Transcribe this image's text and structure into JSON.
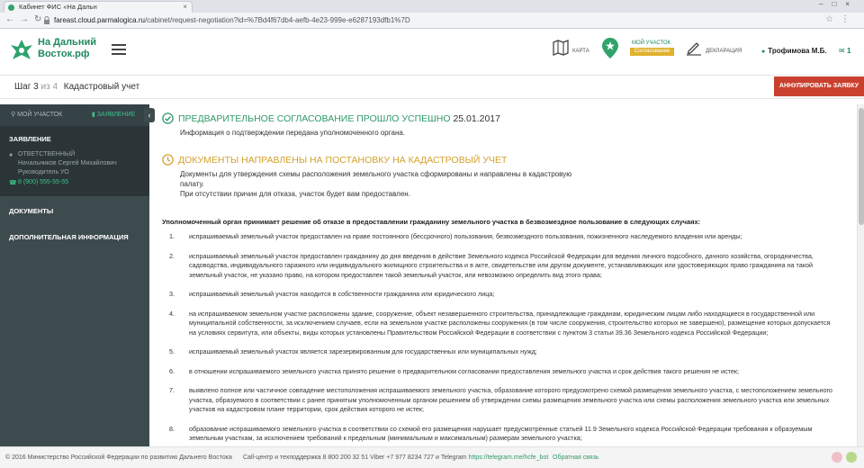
{
  "browser": {
    "tab_title": "Кабинет ФИС «На Дальн",
    "url_host": "fareast.cloud.parmalogica.ru",
    "url_path": "/cabinet/request-negotiation?id=%7Bd4f67db4-aefb-4e23-999e-e6287193dfb1%7D"
  },
  "header": {
    "logo_line1": "На Дальний",
    "logo_line2": "Восток.рф",
    "map_label": "КАРТА",
    "object_label": "МОЙ УЧАСТОК",
    "object_status": "Согласование",
    "declaration_label": "ДЕКЛАРАЦИЯ",
    "user_name": "Трофимова М.Б.",
    "notifications": "1"
  },
  "stepbar": {
    "step": "Шаг 3",
    "of": "из 4",
    "title": "Кадастровый учет",
    "cancel_label": "АННУЛИРОВАТЬ ЗАЯВКУ"
  },
  "sidebar": {
    "tab_my_plot": "МОЙ УЧАСТОК",
    "tab_application": "ЗАЯВЛЕНИЕ",
    "section_title": "ЗАЯВЛЕНИЕ",
    "responsible_label": "ОТВЕТСТВЕННЫЙ",
    "responsible_name": "Начальников Сергей Михайлович",
    "responsible_role": "Руководитель УО",
    "phone": "8 (900) 555-55-55",
    "docs_link": "ДОКУМЕНТЫ",
    "extra_link": "ДОПОЛНИТЕЛЬНАЯ ИНФОРМАЦИЯ"
  },
  "main": {
    "success_title": "ПРЕДВАРИТЕЛЬНОЕ СОГЛАСОВАНИЕ ПРОШЛО УСПЕШНО",
    "success_date": "25.01.2017",
    "success_text": "Информация о подтверждении передана уполномоченного органа.",
    "warn_title": "ДОКУМЕНТЫ НАПРАВЛЕНЫ НА ПОСТАНОВКУ НА КАДАСТРОВЫЙ УЧЕТ",
    "warn_text1": "Документы для утверждения схемы расположения земельного участка сформированы и направлены в кадастровую палату.",
    "warn_text2": "При отсутствии причин для отказа, участок будет вам предоставлен.",
    "intro": "Уполномоченный орган принимает решение об отказе в предоставлении гражданину земельного участка в безвозмездное пользование в следующих случаях:",
    "cases": [
      {
        "n": "1.",
        "text": "испрашиваемый земельный участок предоставлен на праве постоянного (бессрочного) пользования, безвозмездного пользования, пожизненного наследуемого владения или аренды;"
      },
      {
        "n": "2.",
        "text": "испрашиваемый земельный участок предоставлен гражданину до дня введения в действие Земельного кодекса Российской Федерации для ведения личного подсобного, дачного хозяйства, огородничества, садоводства, индивидуального гаражного или индивидуального жилищного строительства и в акте, свидетельстве или другом документе, устанавливающих или удостоверяющих право гражданина на такой земельный участок, не указано право, на котором предоставлен такой земельный участок, или невозможно определить вид этого права;"
      },
      {
        "n": "3.",
        "text": "испрашиваемый земельный участок находится в собственности гражданина или юридического лица;"
      },
      {
        "n": "4.",
        "text": "на испрашиваемом земельном участке расположены здание, сооружение, объект незавершенного строительства, принадлежащие гражданам, юридическим лицам либо находящиеся в государственной или муниципальной собственности, за исключением случаев, если на земельном участке расположены сооружения (в том числе сооружения, строительство которых не завершено), размещение которых допускается на условиях сервитута, или объекты, виды которых установлены Правительством Российской Федерации в соответствии с пунктом 3 статьи 39.36 Земельного кодекса Российской Федерации;"
      },
      {
        "n": "5.",
        "text": "испрашиваемый земельный участок является зарезервированным для государственных или муниципальных нужд;"
      },
      {
        "n": "6.",
        "text": "в отношении испрашиваемого земельного участка принято решение о предварительном согласовании предоставления земельного участка и срок действия такого решения не истек;"
      },
      {
        "n": "7.",
        "text": "выявлено полное или частичное совпадение местоположения испрашиваемого земельного участка, образование которого предусмотрено схемой размещения земельного участка, с местоположением земельного участка, образуемого в соответствии с ранее принятым уполномоченным органом решением об утверждении схемы размещения земельного участка или схемы расположения земельного участка или земельных участков на кадастровом плане территории, срок действия которого не истек;"
      },
      {
        "n": "8.",
        "text": "образование испрашиваемого земельного участка в соответствии со схемой его размещения нарушает предусмотренные статьей 11.9 Земельного кодекса Российской Федерации требования к образуемым земельным участкам, за исключением требований к предельным (минимальным и максимальным) размерам земельного участка;"
      }
    ]
  },
  "footer": {
    "copyright": "© 2016 Министерство Российской Федерации по развитию Дальнего Востока",
    "contact_prefix": "Call-центр и техподдержка 8 800 200 32 51   Viber +7 977 8234 727 и Telegram",
    "telegram_link": "https://telegram.me/hcfe_bot",
    "feedback": "Обратная связь"
  },
  "colors": {
    "accent": "#2f9a6a",
    "warning": "#d4a22f",
    "danger": "#c9412e",
    "sidebar": "#3d4b4f"
  }
}
